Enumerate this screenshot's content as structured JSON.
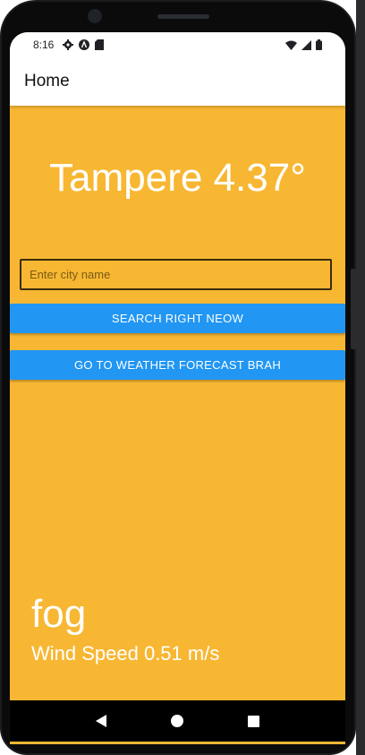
{
  "status_bar": {
    "time": "8:16",
    "left_icons": [
      "settings-gear-icon",
      "android-a-icon",
      "sd-card-icon"
    ],
    "right_icons": [
      "wifi-icon",
      "signal-icon",
      "battery-icon"
    ]
  },
  "app_bar": {
    "title": "Home"
  },
  "main": {
    "city_title": "Tampere 4.37°",
    "search_input": {
      "value": "",
      "placeholder": "Enter city name"
    },
    "search_button_label": "SEARCH RIGHT NEOW",
    "forecast_button_label": "GO TO WEATHER FORECAST BRAH",
    "weather_description": "fog",
    "wind_speed": "Wind Speed 0.51 m/s"
  },
  "colors": {
    "background": "#f7b733",
    "button": "#2196f3",
    "appbar": "#ffffff",
    "text_on_background": "#ffffff"
  },
  "nav_bar": {
    "icons": [
      "back-icon",
      "home-icon",
      "recents-icon"
    ]
  }
}
